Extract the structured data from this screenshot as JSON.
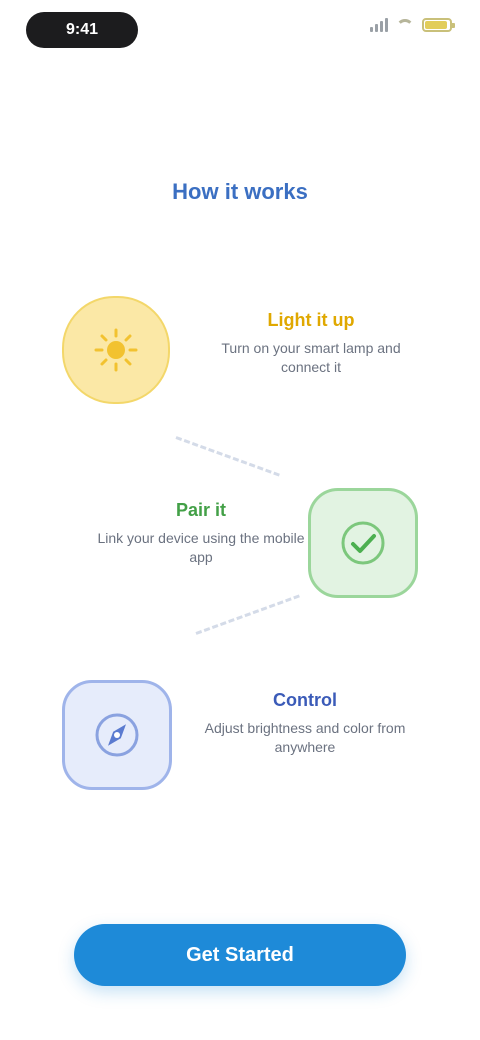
{
  "status_bar": {
    "time": "9:41",
    "icons": [
      "signal-icon",
      "wifi-icon",
      "battery-icon"
    ],
    "battery_level": 0.9
  },
  "heading": "How it works",
  "steps": [
    {
      "title": "Light it up",
      "description": "Turn on your smart lamp and connect it",
      "icon": "sun-icon",
      "accent": "#e0a800"
    },
    {
      "title": "Pair it",
      "description": "Link your device using the mobile app",
      "icon": "check-icon",
      "accent": "#43a047"
    },
    {
      "title": "Control",
      "description": "Adjust brightness and color from anywhere",
      "icon": "compass-icon",
      "accent": "#3b5bb8"
    }
  ],
  "cta": {
    "label": "Get Started",
    "color": "#1e8ad8"
  }
}
